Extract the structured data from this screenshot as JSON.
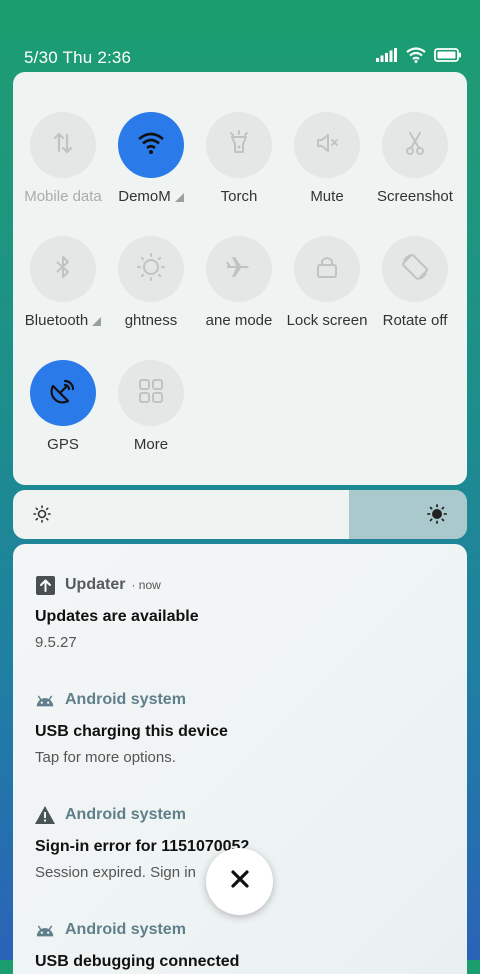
{
  "status_bar": {
    "time": "5/30 Thu 2:36",
    "icons": [
      "signal-icon",
      "wifi-icon",
      "battery-icon"
    ]
  },
  "quick_settings": {
    "tiles": [
      {
        "label": "Mobile data",
        "icon": "mobile-data-icon",
        "active": false
      },
      {
        "label": "DemoM",
        "icon": "wifi-icon",
        "active": true
      },
      {
        "label": "Torch",
        "icon": "torch-icon",
        "active": false
      },
      {
        "label": "Mute",
        "icon": "mute-icon",
        "active": false
      },
      {
        "label": "Screenshot",
        "icon": "screenshot-icon",
        "active": false
      },
      {
        "label": "Bluetooth",
        "icon": "bluetooth-icon",
        "active": false
      },
      {
        "label": "ghtness",
        "icon": "brightness-icon",
        "active": false
      },
      {
        "label": "ane mode",
        "icon": "airplane-icon",
        "active": false
      },
      {
        "label": "Lock screen",
        "icon": "lock-icon",
        "active": false
      },
      {
        "label": "Rotate off",
        "icon": "rotate-icon",
        "active": false
      },
      {
        "label": "GPS",
        "icon": "gps-icon",
        "active": true
      },
      {
        "label": "More",
        "icon": "grid-icon",
        "active": false
      }
    ]
  },
  "brightness": {
    "level": 0.74
  },
  "notifications": [
    {
      "app": "Updater",
      "time": "now",
      "title": "Updates are available",
      "text": "9.5.27",
      "icon": "update-arrow-icon"
    },
    {
      "app": "Android system",
      "title": "USB charging this device",
      "text": "Tap for more options.",
      "icon": "android-icon"
    },
    {
      "app": "Android system",
      "title": "Sign-in error for 1151070052",
      "text": "Session expired. Sign in",
      "icon": "warning-icon"
    },
    {
      "app": "Android system",
      "title": "USB debugging connected",
      "text": "",
      "icon": "android-icon"
    }
  ],
  "colors": {
    "accent": "#2a7ae9",
    "panel": "#eff4f3",
    "tile_bg": "#e3e7e6"
  }
}
